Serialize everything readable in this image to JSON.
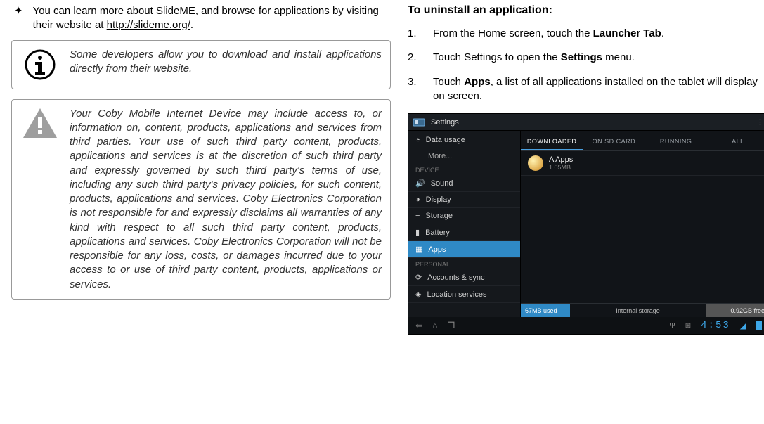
{
  "left": {
    "bullet": {
      "marker": "✦",
      "text_before_link": "You can learn more about SlideME, and browse for applications by visiting their website at ",
      "link_text": "http://slideme.org/",
      "text_after_link": "."
    },
    "info_callout": "Some developers allow you to download and install applications directly from their website.",
    "warning_callout": "Your Coby Mobile Internet Device may include access to, or information on, content, products, applications and services from third parties. Your use of such third party content, products, applications and services is at the discretion of such third party and expressly governed by such third party's terms of use, including any such third party's privacy policies, for such content, products, applications and services. Coby Electronics Corporation is not responsible for and expressly disclaims all warranties of any kind with respect to all such third party content, products, applications and services. Coby Electronics Corporation will not be responsible for any loss, costs, or damages incurred due to your access to or use of third party content, products, applications or services."
  },
  "right": {
    "heading": "To uninstall an application:",
    "steps": [
      {
        "num": "1.",
        "pre": "From the Home screen, touch the ",
        "bold": "Launcher Tab",
        "post": "."
      },
      {
        "num": "2.",
        "pre": "Touch Settings to open the ",
        "bold": "Settings",
        "post": " menu."
      },
      {
        "num": "3.",
        "pre": "Touch ",
        "bold": "Apps",
        "post": ", a list of all applications installed on the tablet will display on screen."
      }
    ],
    "screenshot": {
      "title": "Settings",
      "side": {
        "items_top": [
          {
            "icon": "data",
            "label": "Data usage"
          }
        ],
        "more_label": "More...",
        "device_header": "DEVICE",
        "device_items": [
          {
            "icon": "sound",
            "label": "Sound"
          },
          {
            "icon": "display",
            "label": "Display"
          },
          {
            "icon": "storage",
            "label": "Storage"
          },
          {
            "icon": "battery",
            "label": "Battery"
          },
          {
            "icon": "apps",
            "label": "Apps",
            "selected": true
          }
        ],
        "personal_header": "PERSONAL",
        "personal_items": [
          {
            "icon": "sync",
            "label": "Accounts & sync"
          },
          {
            "icon": "location",
            "label": "Location services"
          }
        ]
      },
      "tabs": [
        "DOWNLOADED",
        "ON SD CARD",
        "RUNNING",
        "ALL"
      ],
      "active_tab": "DOWNLOADED",
      "app": {
        "name": "A Apps",
        "size": "1.05MB"
      },
      "storage": {
        "used": "67MB used",
        "label": "Internal storage",
        "free": "0.92GB free"
      },
      "navbar": {
        "back": "⇐",
        "home": "⌂",
        "recent": "❐",
        "clock": "4:53"
      },
      "menu_dots": "⋮"
    }
  }
}
